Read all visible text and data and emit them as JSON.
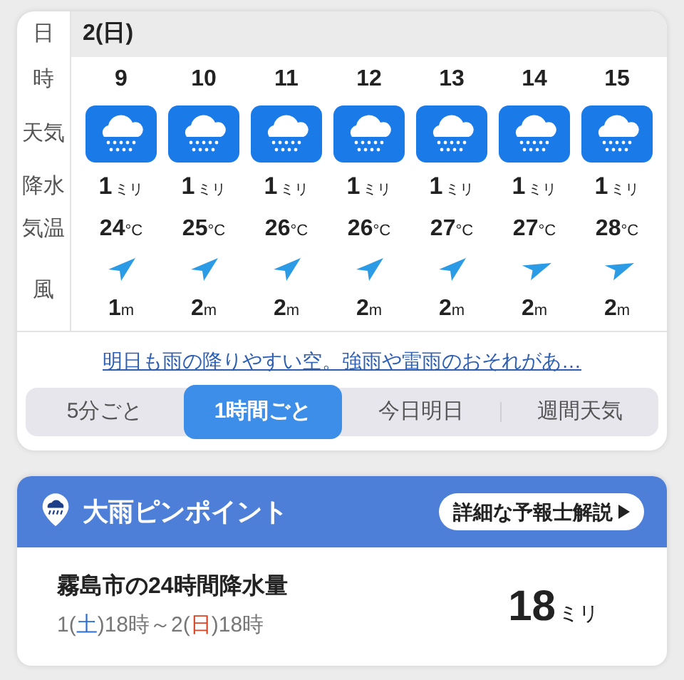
{
  "forecast": {
    "labels": {
      "date": "日",
      "hour": "時",
      "weather": "天気",
      "precip": "降水",
      "temp": "気温",
      "wind": "風"
    },
    "date": "2(日)",
    "hours": [
      {
        "hour": "9",
        "sky": {
          "kind": "rain"
        },
        "precip": "1",
        "precip_unit": "ミリ",
        "temp": "24",
        "temp_unit": "°C",
        "wind_arrow": {
          "kind": "sw"
        },
        "wind": "1",
        "wind_unit": "m"
      },
      {
        "hour": "10",
        "sky": {
          "kind": "rain"
        },
        "precip": "1",
        "precip_unit": "ミリ",
        "temp": "25",
        "temp_unit": "°C",
        "wind_arrow": {
          "kind": "sw"
        },
        "wind": "2",
        "wind_unit": "m"
      },
      {
        "hour": "11",
        "sky": {
          "kind": "rain"
        },
        "precip": "1",
        "precip_unit": "ミリ",
        "temp": "26",
        "temp_unit": "°C",
        "wind_arrow": {
          "kind": "sw"
        },
        "wind": "2",
        "wind_unit": "m"
      },
      {
        "hour": "12",
        "sky": {
          "kind": "rain"
        },
        "precip": "1",
        "precip_unit": "ミリ",
        "temp": "26",
        "temp_unit": "°C",
        "wind_arrow": {
          "kind": "sw"
        },
        "wind": "2",
        "wind_unit": "m"
      },
      {
        "hour": "13",
        "sky": {
          "kind": "rain"
        },
        "precip": "1",
        "precip_unit": "ミリ",
        "temp": "27",
        "temp_unit": "°C",
        "wind_arrow": {
          "kind": "sw"
        },
        "wind": "2",
        "wind_unit": "m"
      },
      {
        "hour": "14",
        "sky": {
          "kind": "rain"
        },
        "precip": "1",
        "precip_unit": "ミリ",
        "temp": "27",
        "temp_unit": "°C",
        "wind_arrow": {
          "kind": "wsw"
        },
        "wind": "2",
        "wind_unit": "m"
      },
      {
        "hour": "15",
        "sky": {
          "kind": "rain"
        },
        "precip": "1",
        "precip_unit": "ミリ",
        "temp": "28",
        "temp_unit": "°C",
        "wind_arrow": {
          "kind": "wsw"
        },
        "wind": "2",
        "wind_unit": "m"
      }
    ],
    "comment_link": "明日も雨の降りやすい空。強雨や雷雨のおそれがあ…",
    "tabs": [
      {
        "label": "5分ごと",
        "selected": false
      },
      {
        "label": "1時間ごと",
        "selected": true
      },
      {
        "label": "今日明日",
        "selected": false
      },
      {
        "label": "週間天気",
        "selected": false
      }
    ]
  },
  "heavy_rain": {
    "title": "大雨ピンポイント",
    "button": "詳細な予報士解説",
    "heading": "霧島市の24時間降水量",
    "period": [
      {
        "text": "1("
      },
      {
        "text": "土",
        "color": "#2f6fd0"
      },
      {
        "text": ")18時～2("
      },
      {
        "text": "日",
        "color": "#d9472b"
      },
      {
        "text": ")18時"
      }
    ],
    "amount": "18",
    "amount_unit": "ミリ"
  }
}
